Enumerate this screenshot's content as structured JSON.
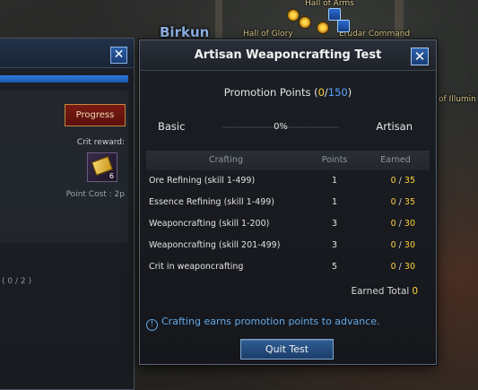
{
  "map": {
    "region": "Birkun",
    "labels": [
      "Hall of Arms",
      "Hall of Glory",
      "Erudar Command",
      "of Illumin"
    ]
  },
  "background_window": {
    "button_label": "Progress",
    "crit_reward_label": "Crit reward:",
    "reward_count": "6",
    "point_cost": "Point Cost : 2p",
    "count_text": "( 0 / 2 )"
  },
  "window": {
    "title": "Artisan Weaponcrafting Test",
    "close_glyph": "✕",
    "promotion": {
      "label": "Promotion Points (",
      "current": "0",
      "separator": "/",
      "max": "150",
      "close_paren": ")"
    },
    "rank": {
      "from": "Basic",
      "to": "Artisan",
      "percent_text": "0%",
      "progress": 0
    },
    "table": {
      "headers": {
        "crafting": "Crafting",
        "points": "Points",
        "earned": "Earned"
      },
      "rows": [
        {
          "name": "Ore Refining (skill 1-499)",
          "points": "1",
          "earned": "0",
          "max": "35"
        },
        {
          "name": "Essence Refining (skill 1-499)",
          "points": "1",
          "earned": "0",
          "max": "35"
        },
        {
          "name": "Weaponcrafting (skill 1-200)",
          "points": "3",
          "earned": "0",
          "max": "30"
        },
        {
          "name": "Weaponcrafting (skill 201-499)",
          "points": "3",
          "earned": "0",
          "max": "30"
        },
        {
          "name": "Crit in weaponcrafting",
          "points": "5",
          "earned": "0",
          "max": "30"
        }
      ]
    },
    "earned_total": {
      "label": "Earned Total",
      "value": "0"
    },
    "info_text": "Crafting earns promotion points to advance.",
    "info_icon": "!",
    "quit_label": "Quit Test"
  },
  "colors": {
    "accent_gold": "#ffd23c",
    "accent_blue": "#5aa0ff",
    "info_blue": "#62a8e8"
  }
}
